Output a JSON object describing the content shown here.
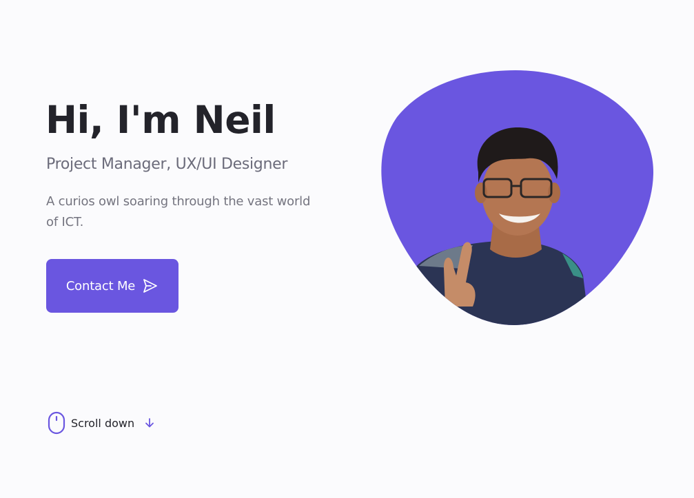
{
  "hero": {
    "title": "Hi, I'm Neil",
    "subtitle": "Project Manager, UX/UI Designer",
    "description": "A curios owl soaring through the vast world of ICT.",
    "contact_label": "Contact Me",
    "contact_icon": "send-icon"
  },
  "scroll": {
    "label": "Scroll down",
    "mouse_icon": "mouse-icon",
    "arrow_icon": "arrow-down-icon"
  },
  "colors": {
    "accent": "#6a56e0",
    "title": "#23232a",
    "subtitle": "#6b6b7a",
    "background": "#fbfbfd"
  }
}
